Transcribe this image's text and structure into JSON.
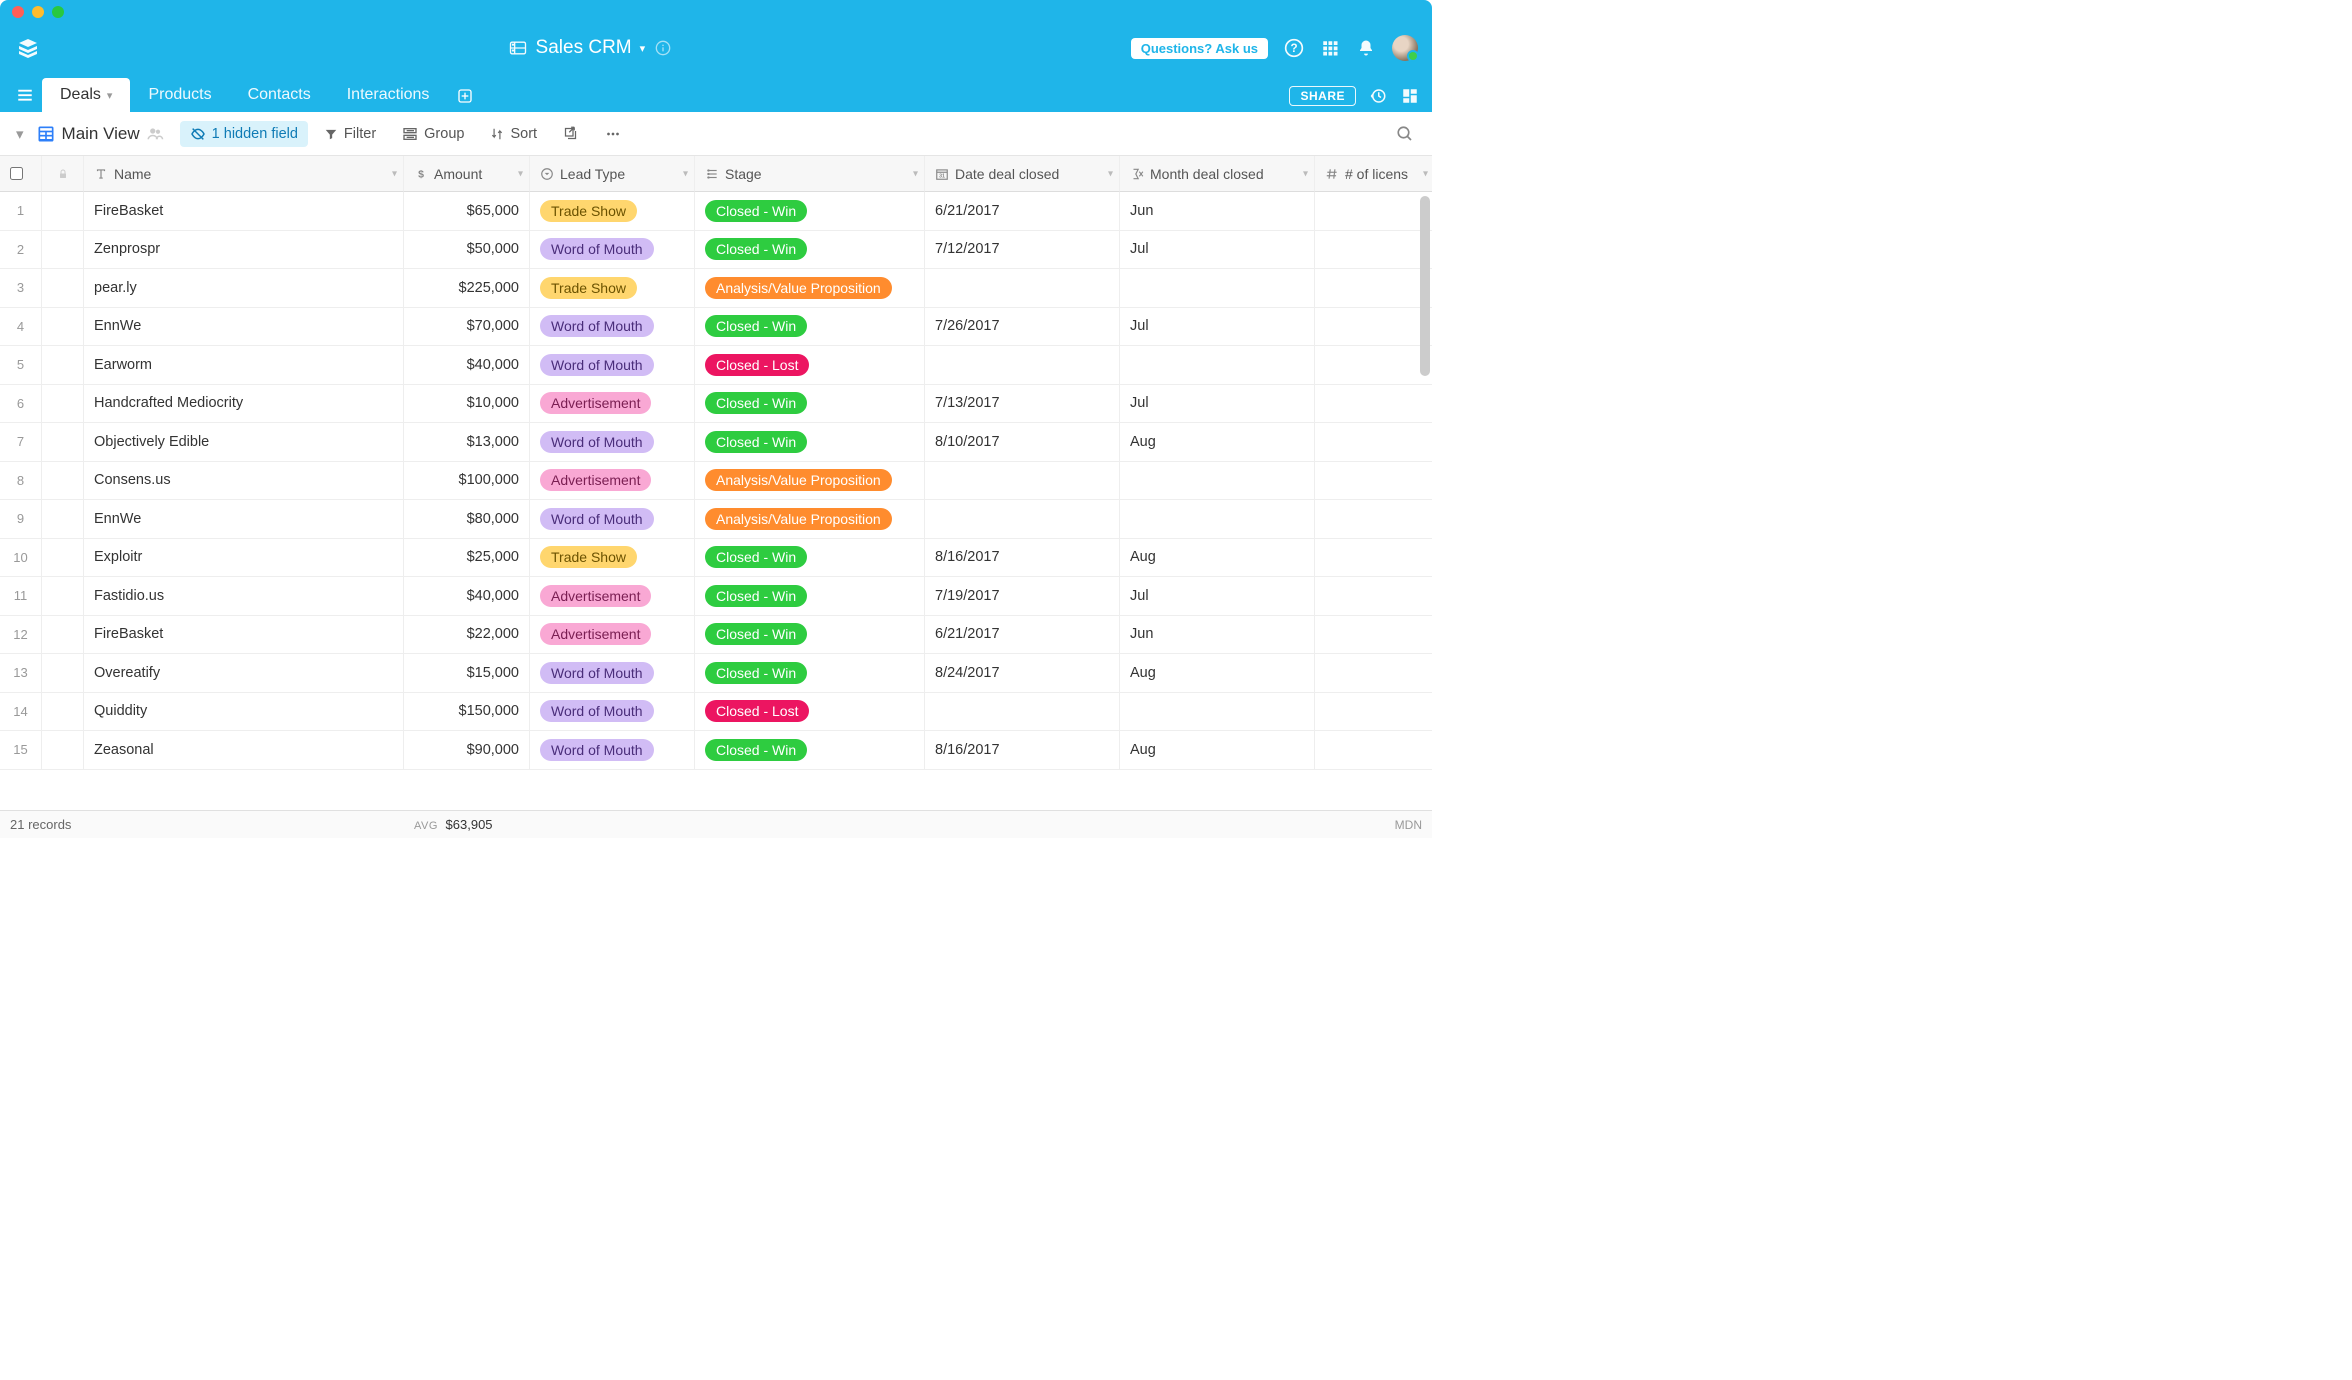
{
  "header": {
    "title": "Sales CRM",
    "ask_label": "Questions? Ask us"
  },
  "tabs": [
    {
      "label": "Deals",
      "active": true
    },
    {
      "label": "Products",
      "active": false
    },
    {
      "label": "Contacts",
      "active": false
    },
    {
      "label": "Interactions",
      "active": false
    }
  ],
  "share_label": "SHARE",
  "toolbar": {
    "view_name": "Main View",
    "hidden_fields": "1 hidden field",
    "filter": "Filter",
    "group": "Group",
    "sort": "Sort"
  },
  "columns": [
    {
      "label": "Name",
      "icon": "text"
    },
    {
      "label": "Amount",
      "icon": "currency"
    },
    {
      "label": "Lead Type",
      "icon": "select"
    },
    {
      "label": "Stage",
      "icon": "select"
    },
    {
      "label": "Date deal closed",
      "icon": "date"
    },
    {
      "label": "Month deal closed",
      "icon": "formula"
    },
    {
      "label": "# of licens",
      "icon": "number"
    }
  ],
  "rows": [
    {
      "num": 1,
      "name": "FireBasket",
      "amount": "$65,000",
      "lead": "Trade Show",
      "lead_cls": "tradeshow",
      "stage": "Closed - Win",
      "stage_cls": "closed-win",
      "date": "6/21/2017",
      "month": "Jun"
    },
    {
      "num": 2,
      "name": "Zenprospr",
      "amount": "$50,000",
      "lead": "Word of Mouth",
      "lead_cls": "wom",
      "stage": "Closed - Win",
      "stage_cls": "closed-win",
      "date": "7/12/2017",
      "month": "Jul"
    },
    {
      "num": 3,
      "name": "pear.ly",
      "amount": "$225,000",
      "lead": "Trade Show",
      "lead_cls": "tradeshow",
      "stage": "Analysis/Value Proposition",
      "stage_cls": "avp",
      "date": "",
      "month": ""
    },
    {
      "num": 4,
      "name": "EnnWe",
      "amount": "$70,000",
      "lead": "Word of Mouth",
      "lead_cls": "wom",
      "stage": "Closed - Win",
      "stage_cls": "closed-win",
      "date": "7/26/2017",
      "month": "Jul"
    },
    {
      "num": 5,
      "name": "Earworm",
      "amount": "$40,000",
      "lead": "Word of Mouth",
      "lead_cls": "wom",
      "stage": "Closed - Lost",
      "stage_cls": "closed-lost",
      "date": "",
      "month": ""
    },
    {
      "num": 6,
      "name": "Handcrafted Mediocrity",
      "amount": "$10,000",
      "lead": "Advertisement",
      "lead_cls": "ad",
      "stage": "Closed - Win",
      "stage_cls": "closed-win",
      "date": "7/13/2017",
      "month": "Jul"
    },
    {
      "num": 7,
      "name": "Objectively Edible",
      "amount": "$13,000",
      "lead": "Word of Mouth",
      "lead_cls": "wom",
      "stage": "Closed - Win",
      "stage_cls": "closed-win",
      "date": "8/10/2017",
      "month": "Aug"
    },
    {
      "num": 8,
      "name": "Consens.us",
      "amount": "$100,000",
      "lead": "Advertisement",
      "lead_cls": "ad",
      "stage": "Analysis/Value Proposition",
      "stage_cls": "avp",
      "date": "",
      "month": ""
    },
    {
      "num": 9,
      "name": "EnnWe",
      "amount": "$80,000",
      "lead": "Word of Mouth",
      "lead_cls": "wom",
      "stage": "Analysis/Value Proposition",
      "stage_cls": "avp",
      "date": "",
      "month": ""
    },
    {
      "num": 10,
      "name": "Exploitr",
      "amount": "$25,000",
      "lead": "Trade Show",
      "lead_cls": "tradeshow",
      "stage": "Closed - Win",
      "stage_cls": "closed-win",
      "date": "8/16/2017",
      "month": "Aug"
    },
    {
      "num": 11,
      "name": "Fastidio.us",
      "amount": "$40,000",
      "lead": "Advertisement",
      "lead_cls": "ad",
      "stage": "Closed - Win",
      "stage_cls": "closed-win",
      "date": "7/19/2017",
      "month": "Jul"
    },
    {
      "num": 12,
      "name": "FireBasket",
      "amount": "$22,000",
      "lead": "Advertisement",
      "lead_cls": "ad",
      "stage": "Closed - Win",
      "stage_cls": "closed-win",
      "date": "6/21/2017",
      "month": "Jun"
    },
    {
      "num": 13,
      "name": "Overeatify",
      "amount": "$15,000",
      "lead": "Word of Mouth",
      "lead_cls": "wom",
      "stage": "Closed - Win",
      "stage_cls": "closed-win",
      "date": "8/24/2017",
      "month": "Aug"
    },
    {
      "num": 14,
      "name": "Quiddity",
      "amount": "$150,000",
      "lead": "Word of Mouth",
      "lead_cls": "wom",
      "stage": "Closed - Lost",
      "stage_cls": "closed-lost",
      "date": "",
      "month": ""
    },
    {
      "num": 15,
      "name": "Zeasonal",
      "amount": "$90,000",
      "lead": "Word of Mouth",
      "lead_cls": "wom",
      "stage": "Closed - Win",
      "stage_cls": "closed-win",
      "date": "8/16/2017",
      "month": "Aug"
    }
  ],
  "footer": {
    "record_count": "21 records",
    "avg_label": "AVG",
    "avg_value": "$63,905",
    "mdn": "MDN"
  }
}
